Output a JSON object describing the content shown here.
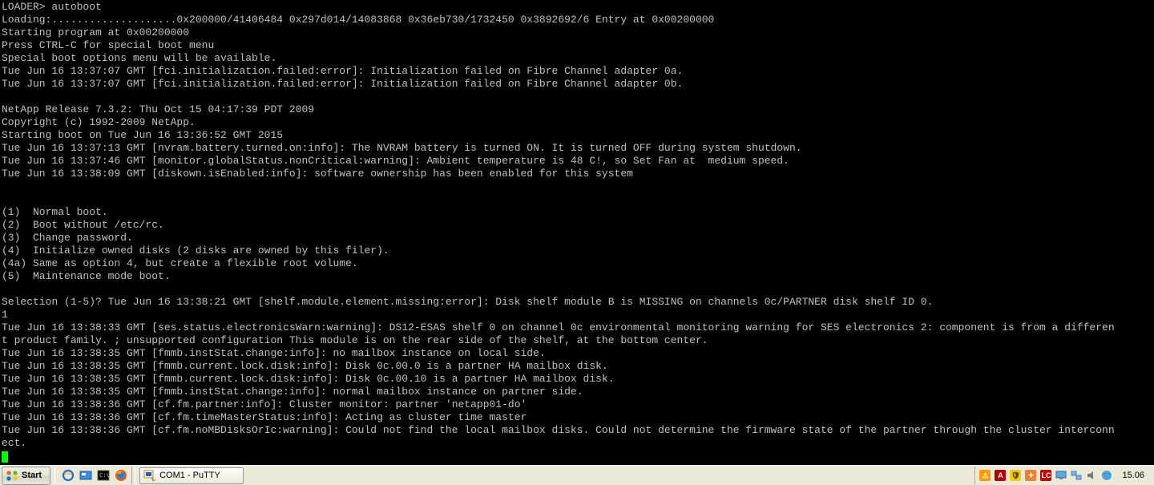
{
  "terminal": {
    "line1": "LOADER> autoboot",
    "line2": "Loading:....................0x200000/41406484 0x297d014/14083868 0x36eb730/1732450 0x3892692/6 Entry at 0x00200000",
    "line3": "Starting program at 0x00200000",
    "line4": "Press CTRL-C for special boot menu",
    "line5": "Special boot options menu will be available.",
    "line6": "Tue Jun 16 13:37:07 GMT [fci.initialization.failed:error]: Initialization failed on Fibre Channel adapter 0a.",
    "line7": "Tue Jun 16 13:37:07 GMT [fci.initialization.failed:error]: Initialization failed on Fibre Channel adapter 0b.",
    "line8": "",
    "line9": "NetApp Release 7.3.2: Thu Oct 15 04:17:39 PDT 2009",
    "line10": "Copyright (c) 1992-2009 NetApp.",
    "line11": "Starting boot on Tue Jun 16 13:36:52 GMT 2015",
    "line12": "Tue Jun 16 13:37:13 GMT [nvram.battery.turned.on:info]: The NVRAM battery is turned ON. It is turned OFF during system shutdown.",
    "line13": "Tue Jun 16 13:37:46 GMT [monitor.globalStatus.nonCritical:warning]: Ambient temperature is 48 C!, so Set Fan at  medium speed.",
    "line14": "Tue Jun 16 13:38:09 GMT [diskown.isEnabled:info]: software ownership has been enabled for this system",
    "line15": "",
    "line16": "",
    "line17": "(1)  Normal boot.",
    "line18": "(2)  Boot without /etc/rc.",
    "line19": "(3)  Change password.",
    "line20": "(4)  Initialize owned disks (2 disks are owned by this filer).",
    "line21": "(4a) Same as option 4, but create a flexible root volume.",
    "line22": "(5)  Maintenance mode boot.",
    "line23": "",
    "line24": "Selection (1-5)? Tue Jun 16 13:38:21 GMT [shelf.module.element.missing:error]: Disk shelf module B is MISSING on channels 0c/PARTNER disk shelf ID 0.",
    "line25": "1",
    "line26": "Tue Jun 16 13:38:33 GMT [ses.status.electronicsWarn:warning]: DS12-ESAS shelf 0 on channel 0c environmental monitoring warning for SES electronics 2: component is from a differen",
    "line27": "t product family. ; unsupported configuration This module is on the rear side of the shelf, at the bottom center.",
    "line28": "Tue Jun 16 13:38:35 GMT [fmmb.instStat.change:info]: no mailbox instance on local side.",
    "line29": "Tue Jun 16 13:38:35 GMT [fmmb.current.lock.disk:info]: Disk 0c.00.0 is a partner HA mailbox disk.",
    "line30": "Tue Jun 16 13:38:35 GMT [fmmb.current.lock.disk:info]: Disk 0c.00.10 is a partner HA mailbox disk.",
    "line31": "Tue Jun 16 13:38:35 GMT [fmmb.instStat.change:info]: normal mailbox instance on partner side.",
    "line32": "Tue Jun 16 13:38:36 GMT [cf.fm.partner:info]: Cluster monitor: partner 'netapp01-do'",
    "line33": "Tue Jun 16 13:38:36 GMT [cf.fm.timeMasterStatus:info]: Acting as cluster time master",
    "line34": "Tue Jun 16 13:38:36 GMT [cf.fm.noMBDisksOrIc:warning]: Could not find the local mailbox disks. Could not determine the firmware state of the partner through the cluster interconn",
    "line35": "ect."
  },
  "taskbar": {
    "start": "Start",
    "task1": "COM1 - PuTTY",
    "clock": "15.06"
  }
}
